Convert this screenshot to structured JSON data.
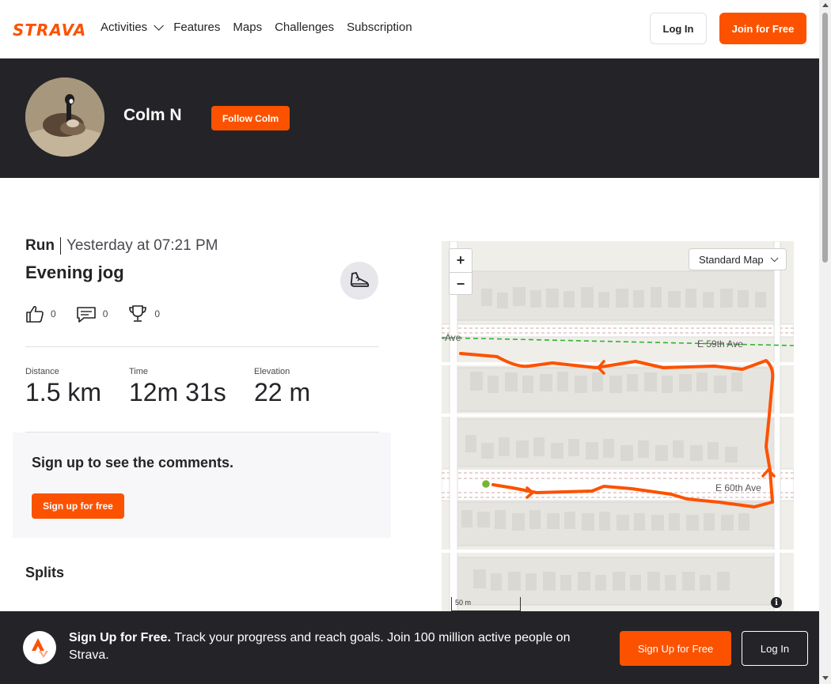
{
  "brand": {
    "logo_text": "STRAVA",
    "accent_color": "#fc5200"
  },
  "nav": {
    "items": [
      {
        "label": "Activities",
        "has_dropdown": true
      },
      {
        "label": "Features"
      },
      {
        "label": "Maps"
      },
      {
        "label": "Challenges"
      },
      {
        "label": "Subscription"
      }
    ],
    "login_label": "Log In",
    "join_label": "Join for Free"
  },
  "athlete": {
    "name": "Colm N",
    "follow_label": "Follow Colm"
  },
  "activity": {
    "type": "Run",
    "date": "Yesterday at 07:21 PM",
    "title": "Evening jog",
    "kudos_count": "0",
    "comments_count": "0",
    "achievements_count": "0",
    "stats": [
      {
        "label": "Distance",
        "value": "1.5 km"
      },
      {
        "label": "Time",
        "value": "12m 31s"
      },
      {
        "label": "Elevation",
        "value": "22 m"
      }
    ]
  },
  "comments": {
    "title": "Sign up to see the comments.",
    "button_label": "Sign up for free"
  },
  "splits": {
    "title": "Splits"
  },
  "map": {
    "style_label": "Standard Map",
    "zoom_in": "+",
    "zoom_out": "−",
    "scale_label": "50 m",
    "streets": [
      "E 59th Ave",
      "E 60th Ave"
    ],
    "info_glyph": "i"
  },
  "banner": {
    "headline": "Sign Up for Free.",
    "body": "Track your progress and reach goals. Join 100 million active people on Strava.",
    "signup_label": "Sign Up for Free",
    "login_label": "Log In"
  }
}
